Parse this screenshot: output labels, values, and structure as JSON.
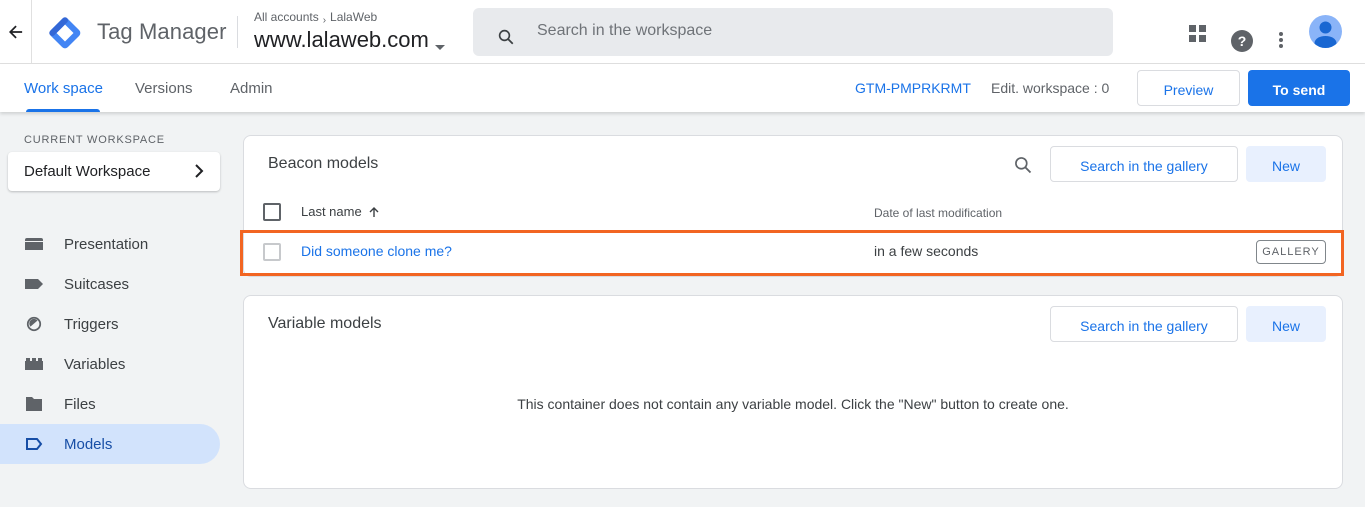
{
  "header": {
    "product_name": "Tag Manager",
    "breadcrumb": [
      "All accounts",
      "LalaWeb"
    ],
    "container_name": "www.lalaweb.com",
    "search_placeholder": "Search in the workspace",
    "search_value": "",
    "icons": [
      "back-arrow-icon",
      "tag-manager-logo-icon",
      "search-icon",
      "apps-grid-icon",
      "help-icon",
      "more-vert-icon",
      "account-avatar-icon"
    ]
  },
  "subbar": {
    "tabs": [
      {
        "label": "Work space",
        "active": true
      },
      {
        "label": "Versions",
        "active": false
      },
      {
        "label": "Admin",
        "active": false
      }
    ],
    "container_id": "GTM-PMPRKRMT",
    "workspace_changes": "Edit. workspace : 0",
    "preview_label": "Preview",
    "submit_label": "To send"
  },
  "sidebar": {
    "current_workspace_label": "CURRENT WORKSPACE",
    "workspace_name": "Default Workspace",
    "items": [
      {
        "label": "Presentation",
        "icon": "overview-icon",
        "active": false
      },
      {
        "label": "Suitcases",
        "icon": "tag-icon",
        "active": false
      },
      {
        "label": "Triggers",
        "icon": "trigger-icon",
        "active": false
      },
      {
        "label": "Variables",
        "icon": "variables-icon",
        "active": false
      },
      {
        "label": "Files",
        "icon": "folder-icon",
        "active": false
      },
      {
        "label": "Models",
        "icon": "template-icon",
        "active": true
      }
    ]
  },
  "beacon_models": {
    "title": "Beacon models",
    "search_gallery_label": "Search in the gallery",
    "new_label": "New",
    "columns": {
      "name": "Last name",
      "sort": "ascending",
      "date": "Date of last modification"
    },
    "rows": [
      {
        "name": "Did someone clone me?",
        "modified": "in a few seconds",
        "badge": "GALLERY",
        "highlighted": true
      }
    ]
  },
  "variable_models": {
    "title": "Variable models",
    "search_gallery_label": "Search in the gallery",
    "new_label": "New",
    "empty_message": "This container does not contain any variable model. Click the \"New\" button to create one."
  },
  "colors": {
    "accent": "#1a73e8",
    "active_nav_bg": "#d2e3fc",
    "highlight_border": "#f26522",
    "page_bg": "#f1f3f4"
  }
}
